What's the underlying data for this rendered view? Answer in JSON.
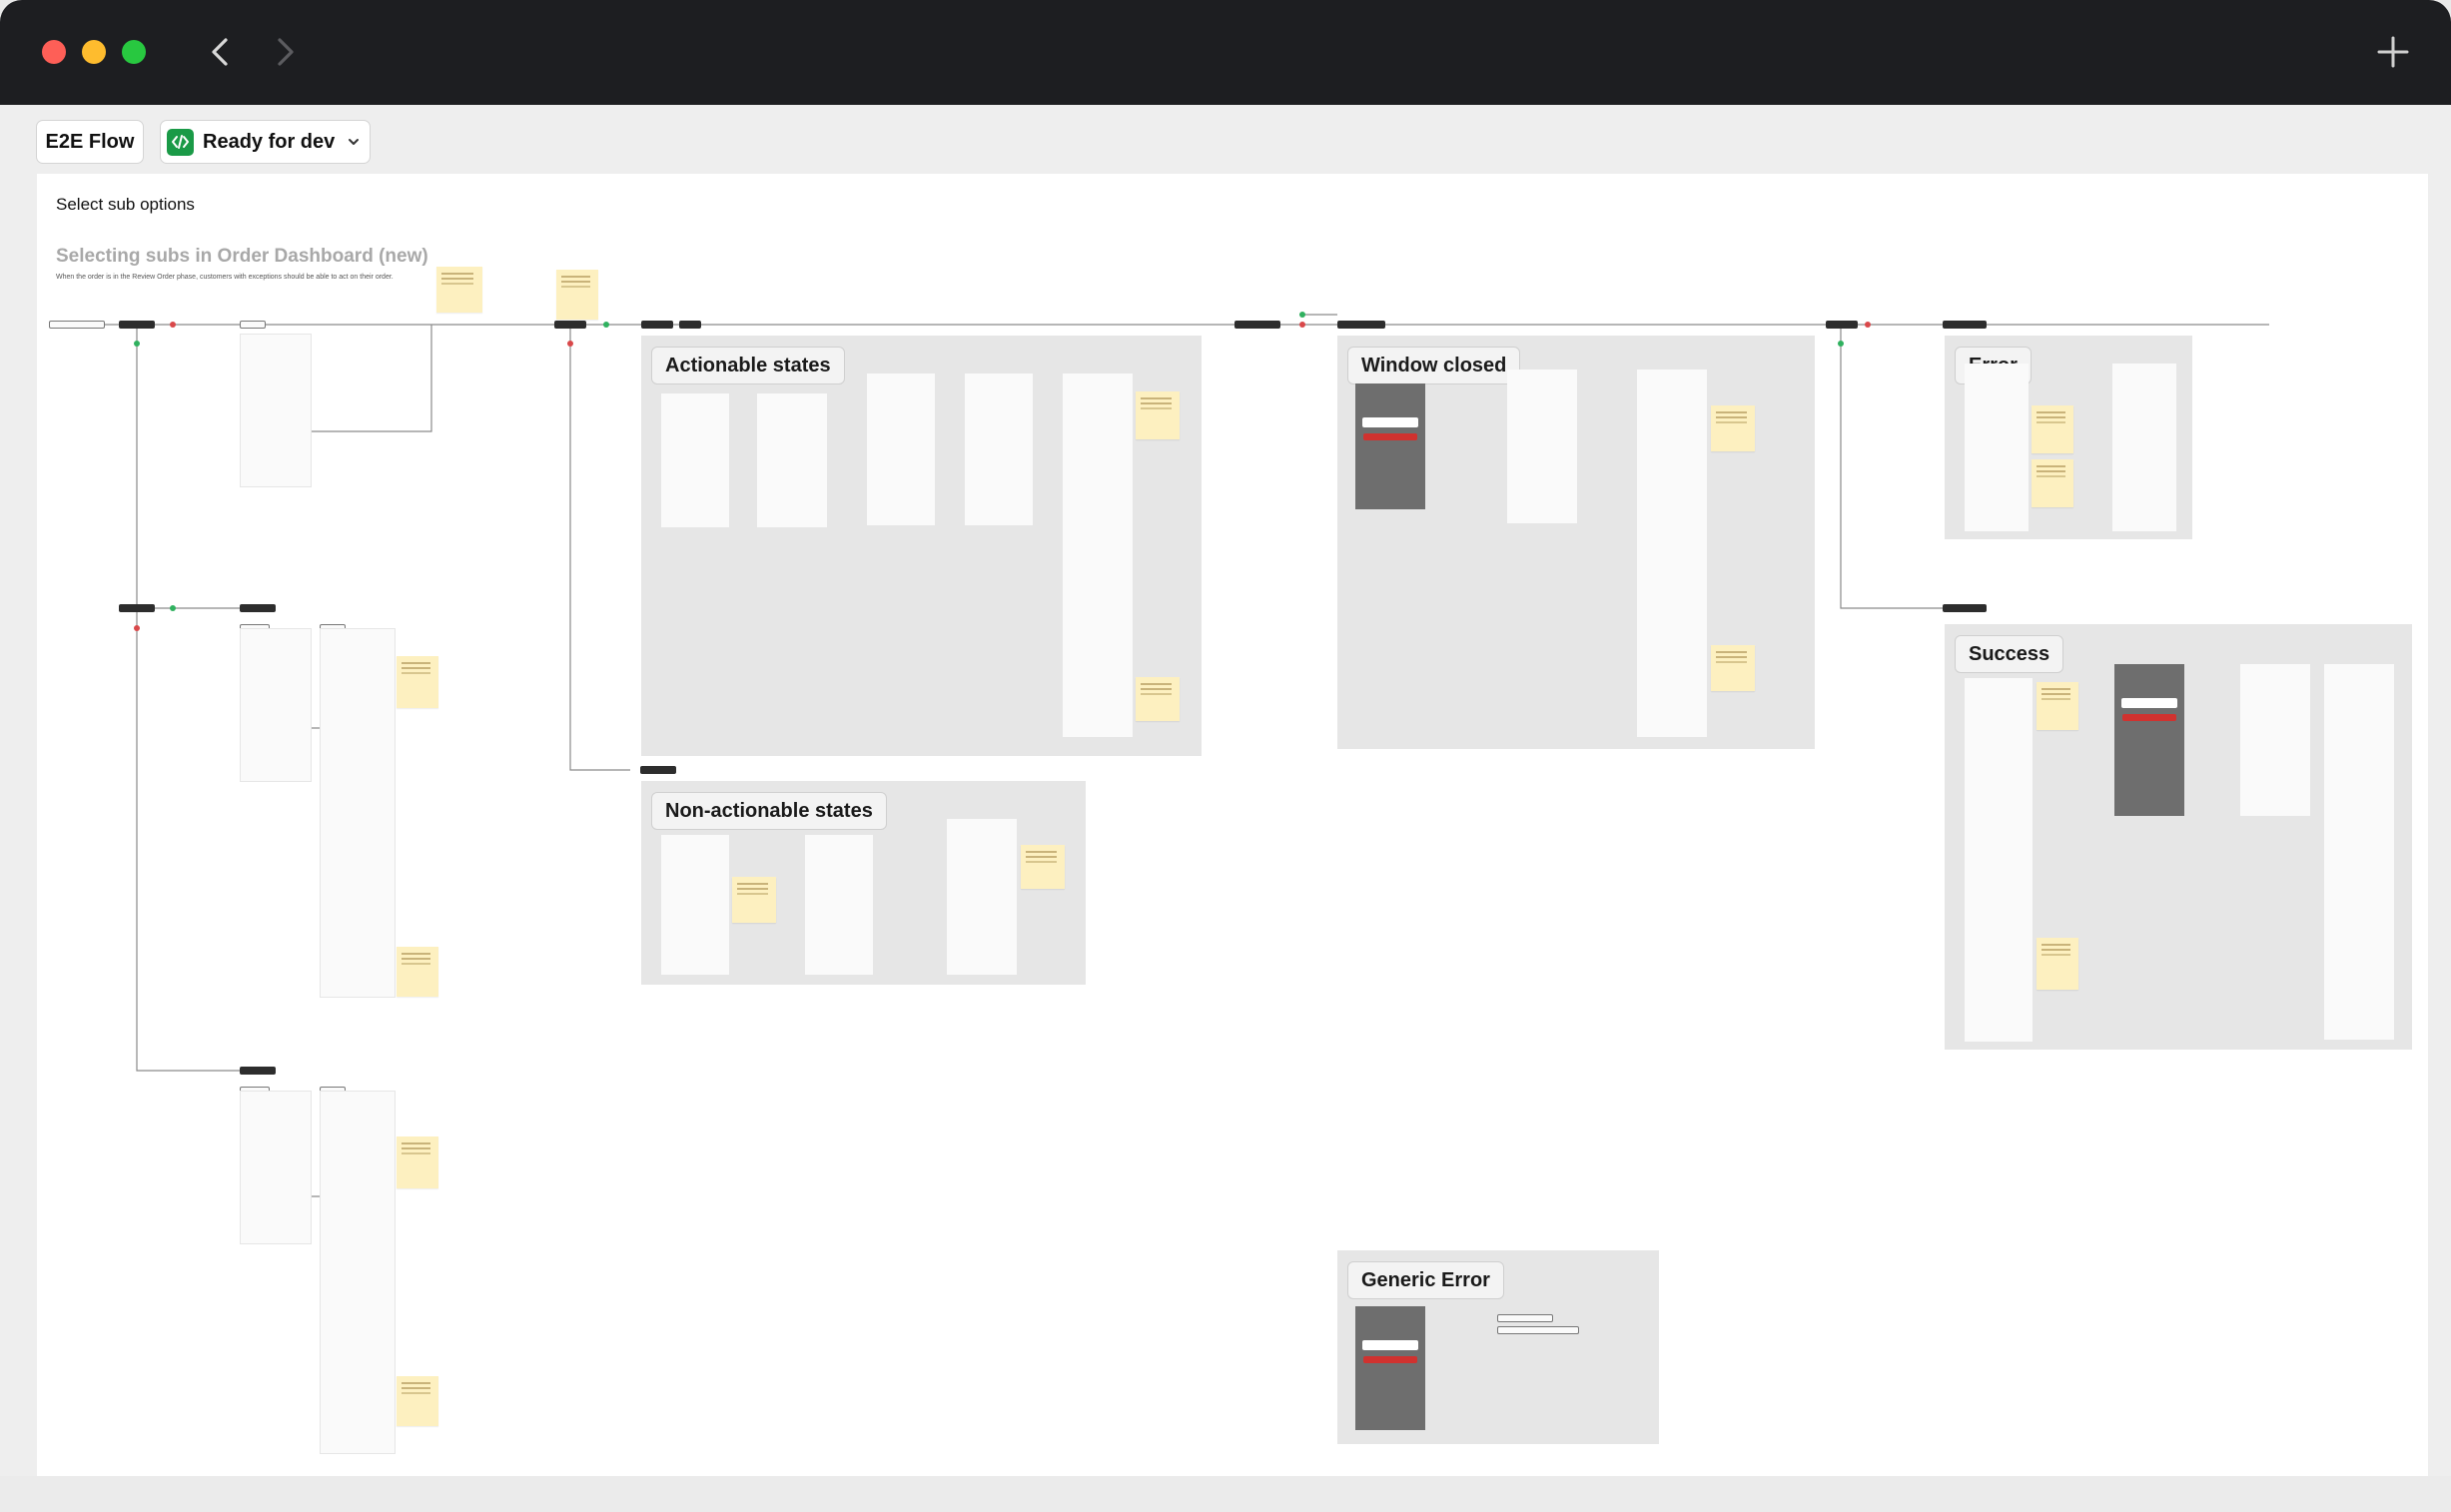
{
  "window": {
    "controls": [
      "close",
      "minimize",
      "zoom"
    ],
    "nav": {
      "back_icon": "chevron-left-icon",
      "forward_icon": "chevron-right-icon",
      "new_tab_icon": "plus-icon"
    }
  },
  "toolbar": {
    "flow_label": "E2E Flow",
    "status_label": "Ready for dev",
    "status_icon": "code-icon",
    "status_color": "#1a9a47",
    "dropdown_icon": "chevron-down-icon"
  },
  "canvas": {
    "title": "Select sub options",
    "section_title": "Selecting subs in Order Dashboard (new)",
    "section_description": "When the order is in the Review Order phase, customers with exceptions should be able to act on their order.",
    "groups": {
      "actionable": "Actionable states",
      "non_actionable": "Non-actionable states",
      "window_closed": "Window closed",
      "error": "Error",
      "success": "Success",
      "generic_error": "Generic Error"
    },
    "accent_colors": {
      "sticky_note": "#fdf0c0",
      "connector_ok": "#30b15f",
      "connector_fail": "#d9484a",
      "cta": "#d0322f"
    }
  }
}
